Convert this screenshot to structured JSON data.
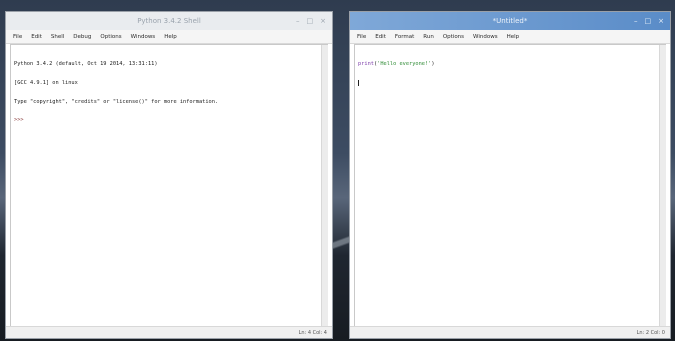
{
  "shell_window": {
    "title": "Python 3.4.2 Shell",
    "controls": {
      "minimize": "–",
      "maximize": "□",
      "close": "×"
    },
    "menu": [
      "File",
      "Edit",
      "Shell",
      "Debug",
      "Options",
      "Windows",
      "Help"
    ],
    "lines": [
      "Python 3.4.2 (default, Oct 19 2014, 13:31:11)",
      "[GCC 4.9.1] on linux",
      "Type \"copyright\", \"credits\" or \"license()\" for more information.",
      ">>>"
    ],
    "status": "Ln: 4 Col: 4"
  },
  "editor_window": {
    "title": "*Untitled*",
    "controls": {
      "minimize": "–",
      "maximize": "□",
      "close": "×"
    },
    "menu": [
      "File",
      "Edit",
      "Format",
      "Run",
      "Options",
      "Windows",
      "Help"
    ],
    "code": {
      "builtin": "print",
      "open": "(",
      "string": "'Hello everyone!'",
      "close": ")"
    },
    "status": "Ln: 2 Col: 0"
  },
  "colors": {
    "active_title": "#5a8cc8",
    "inactive_title": "#e9ecef",
    "builtin": "#7a39a8",
    "string": "#2d8a33"
  }
}
